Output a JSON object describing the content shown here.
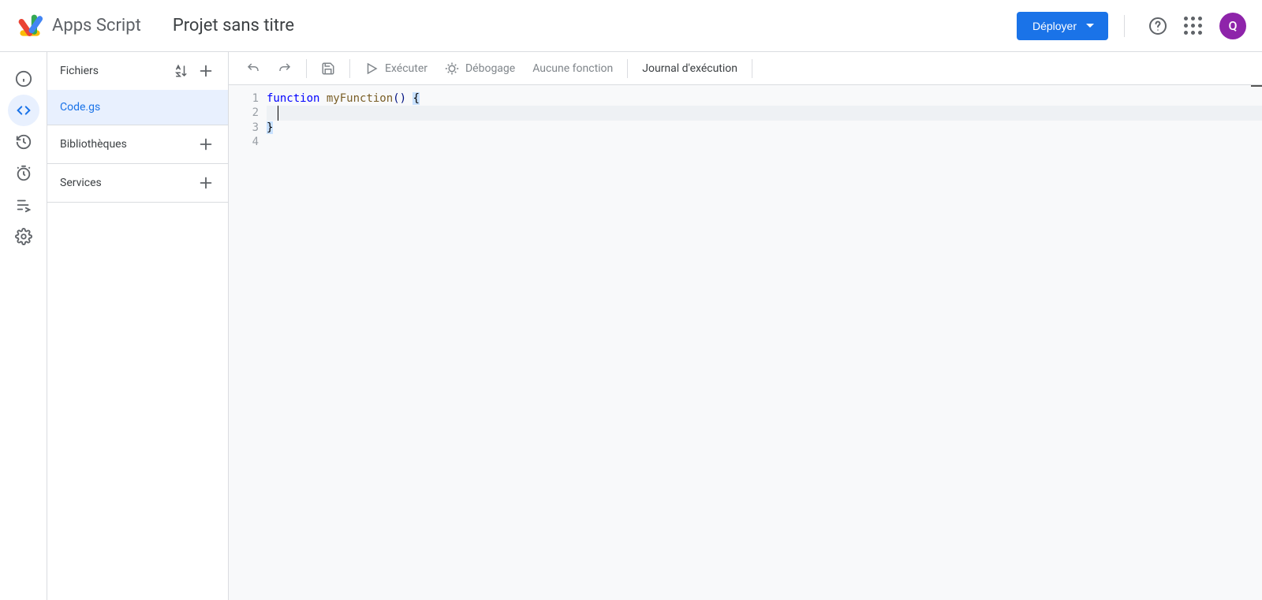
{
  "header": {
    "app_name": "Apps Script",
    "project_title": "Projet sans titre",
    "deploy_label": "Déployer",
    "avatar_initial": "Q"
  },
  "sidebar": {
    "files_label": "Fichiers",
    "libraries_label": "Bibliothèques",
    "services_label": "Services",
    "files": [
      {
        "name": "Code.gs",
        "active": true
      }
    ]
  },
  "toolbar": {
    "run": "Exécuter",
    "debug": "Débogage",
    "no_function": "Aucune fonction",
    "exec_log": "Journal d'exécution"
  },
  "editor": {
    "line_numbers": [
      "1",
      "2",
      "3",
      "4"
    ],
    "tokens": {
      "l1_kw": "function",
      "l1_fn": "myFunction",
      "l1_paren": "()",
      "l1_brace": "{",
      "l2": "  ",
      "l3_brace": "}",
      "l4": ""
    }
  }
}
